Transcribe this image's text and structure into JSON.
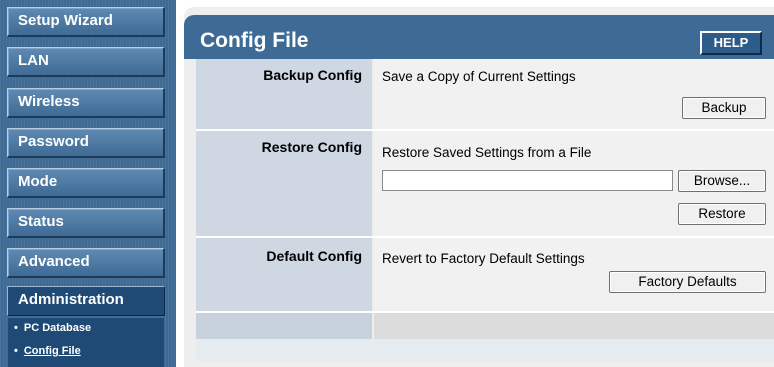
{
  "sidebar": {
    "items": [
      {
        "label": "Setup Wizard"
      },
      {
        "label": "LAN"
      },
      {
        "label": "Wireless"
      },
      {
        "label": "Password"
      },
      {
        "label": "Mode"
      },
      {
        "label": "Status"
      },
      {
        "label": "Advanced"
      },
      {
        "label": "Administration"
      }
    ],
    "subitems": [
      {
        "label": "PC Database"
      },
      {
        "label": "Config File"
      }
    ]
  },
  "header": {
    "title": "Config File",
    "help": "HELP"
  },
  "rows": {
    "backup": {
      "label": "Backup Config",
      "desc": "Save a Copy of Current Settings",
      "button": "Backup"
    },
    "restore": {
      "label": "Restore Config",
      "desc": "Restore Saved Settings from a File",
      "file_value": "",
      "browse": "Browse...",
      "button": "Restore"
    },
    "default": {
      "label": "Default Config",
      "desc": "Revert to Factory Default Settings",
      "button": "Factory Defaults"
    }
  },
  "colors": {
    "header": "#3d6b96",
    "sidebar": "#3e6a94",
    "label_cell": "#cfd8e2"
  }
}
